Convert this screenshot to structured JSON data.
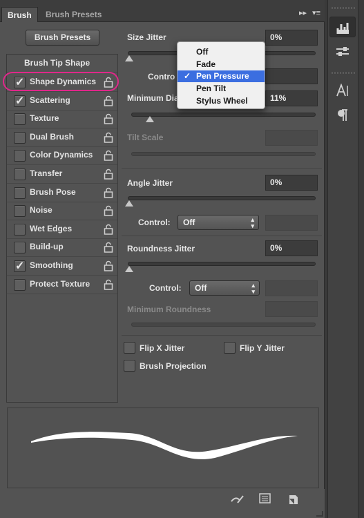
{
  "tabs": {
    "active": "Brush",
    "inactive": "Brush Presets"
  },
  "presets_button": "Brush Presets",
  "brush_tip_shape": "Brush Tip Shape",
  "options": [
    {
      "label": "Shape Dynamics",
      "checked": true
    },
    {
      "label": "Scattering",
      "checked": true
    },
    {
      "label": "Texture",
      "checked": false
    },
    {
      "label": "Dual Brush",
      "checked": false
    },
    {
      "label": "Color Dynamics",
      "checked": false
    },
    {
      "label": "Transfer",
      "checked": false
    },
    {
      "label": "Brush Pose",
      "checked": false
    },
    {
      "label": "Noise",
      "checked": false
    },
    {
      "label": "Wet Edges",
      "checked": false
    },
    {
      "label": "Build-up",
      "checked": false
    },
    {
      "label": "Smoothing",
      "checked": true
    },
    {
      "label": "Protect Texture",
      "checked": false
    }
  ],
  "size_jitter": {
    "label": "Size Jitter",
    "value": "0%"
  },
  "control_label": "Contro",
  "min_diameter": {
    "label": "Minimum Dia",
    "value": "11%"
  },
  "tilt_scale": {
    "label": "Tilt Scale"
  },
  "angle_jitter": {
    "label": "Angle Jitter",
    "value": "0%",
    "control_label": "Control:",
    "control_value": "Off"
  },
  "roundness_jitter": {
    "label": "Roundness Jitter",
    "value": "0%",
    "control_label": "Control:",
    "control_value": "Off"
  },
  "min_roundness": {
    "label": "Minimum Roundness"
  },
  "flip_x": "Flip X Jitter",
  "flip_y": "Flip Y Jitter",
  "brush_projection": "Brush Projection",
  "dropdown": {
    "items": [
      "Off",
      "Fade",
      "Pen Pressure",
      "Pen Tilt",
      "Stylus Wheel"
    ],
    "selected": "Pen Pressure",
    "check": "✓"
  },
  "tab_icons": {
    "forward": "▸▸",
    "menu": "▾≡"
  },
  "colors": {
    "highlight": "#e0288a",
    "selection": "#3b6ee0",
    "panel": "#535353"
  }
}
